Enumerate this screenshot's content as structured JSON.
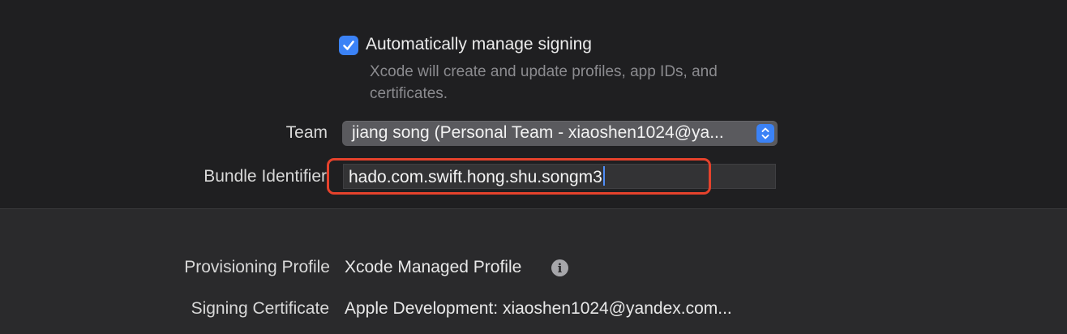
{
  "signing": {
    "auto_manage_label": "Automatically manage signing",
    "auto_manage_checked": true,
    "auto_manage_help": "Xcode will create and update profiles, app IDs, and certificates."
  },
  "team": {
    "label": "Team",
    "value": "jiang song (Personal Team - xiaoshen1024@ya..."
  },
  "bundle": {
    "label": "Bundle Identifier",
    "value": "hado.com.swift.hong.shu.songm3"
  },
  "provisioning": {
    "label": "Provisioning Profile",
    "value": "Xcode Managed Profile",
    "info_icon": "info-icon"
  },
  "certificate": {
    "label": "Signing Certificate",
    "value": "Apple Development: xiaoshen1024@yandex.com..."
  },
  "colors": {
    "accent": "#3b82f6",
    "highlight": "#e5422c",
    "background_top": "#1f1f21",
    "background_bottom": "#2a2a2c"
  }
}
